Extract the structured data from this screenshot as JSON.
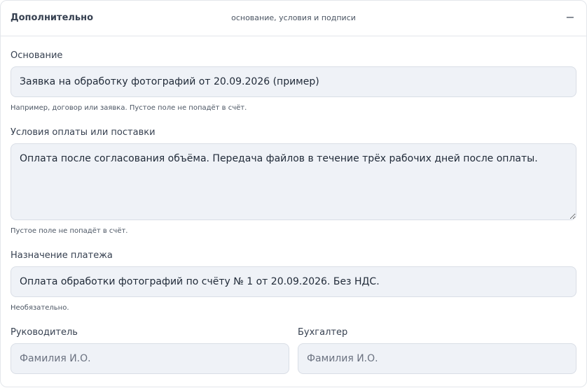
{
  "header": {
    "title": "Дополнительно",
    "subtitle": "основание, условия и подписи",
    "collapse_symbol": "−"
  },
  "basis": {
    "label": "Основание",
    "value": "Заявка на обработку фотографий от 20.09.2026 (пример)",
    "hint": "Например, договор или заявка. Пустое поле не попадёт в счёт."
  },
  "terms": {
    "label": "Условия оплаты или поставки",
    "value": "Оплата после согласования объёма. Передача файлов в течение трёх рабочих дней после оплаты.",
    "hint": "Пустое поле не попадёт в счёт."
  },
  "purpose": {
    "label": "Назначение платежа",
    "value": "Оплата обработки фотографий по счёту № 1 от 20.09.2026. Без НДС.",
    "hint": "Необязательно."
  },
  "director": {
    "label": "Руководитель",
    "value": "",
    "placeholder": "Фамилия И.О."
  },
  "accountant": {
    "label": "Бухгалтер",
    "value": "",
    "placeholder": "Фамилия И.О."
  }
}
